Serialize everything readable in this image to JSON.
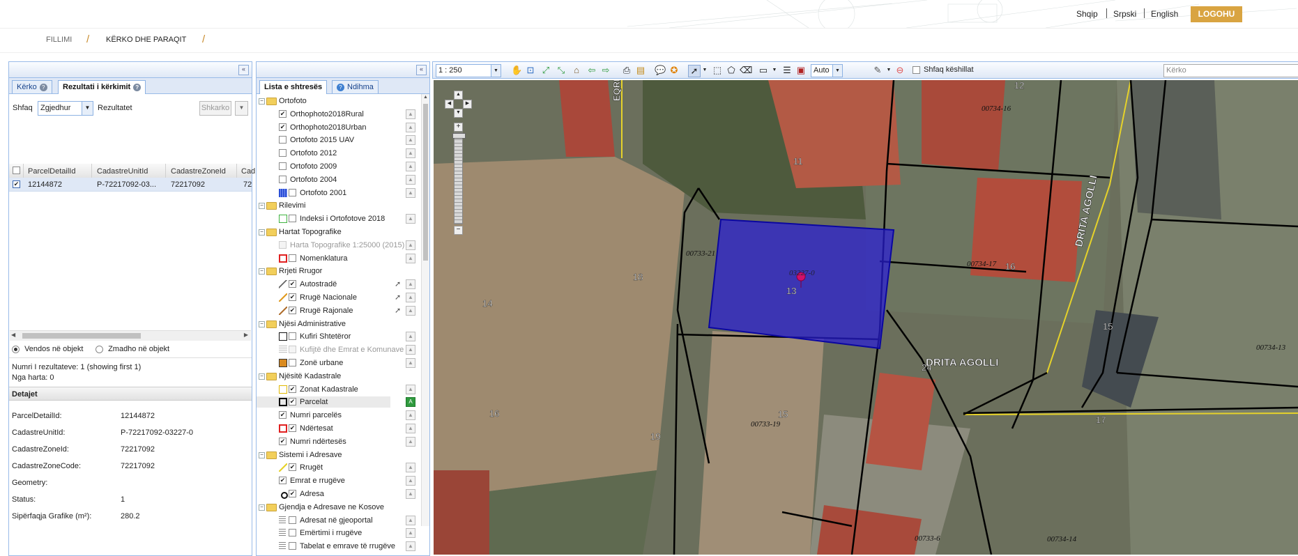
{
  "header": {
    "languages": [
      "Shqip",
      "Srpski",
      "English"
    ],
    "logout_label": "LOGOHU"
  },
  "breadcrumb": {
    "items": [
      "FILLIMI",
      "KËRKO DHE PARAQIT"
    ]
  },
  "left_panel": {
    "tabs": [
      {
        "label": "Kërko"
      },
      {
        "label": "Rezultati i kërkimit"
      }
    ],
    "filter": {
      "label": "Shfaq",
      "select_value": "Zgjedhur",
      "results_label": "Rezultatet",
      "clear_button": "Shkarko"
    },
    "grid": {
      "columns": [
        "ParcelDetailId",
        "CadastreUnitId",
        "CadastreZoneId",
        "Cad"
      ],
      "rows": [
        {
          "checked": true,
          "cells": [
            "12144872",
            "P-72217092-03...",
            "72217092",
            "72"
          ]
        }
      ]
    },
    "radio_options": [
      {
        "label": "Vendos në objekt",
        "selected": true
      },
      {
        "label": "Zmadho në objekt",
        "selected": false
      }
    ],
    "results_count": "Numri I rezultateve: 1 (showing first 1)",
    "from_map": "Nga harta: 0",
    "details_title": "Detajet",
    "details": [
      {
        "label": "ParcelDetailId:",
        "value": "12144872"
      },
      {
        "label": "CadastreUnitId:",
        "value": "P-72217092-03227-0"
      },
      {
        "label": "CadastreZoneId:",
        "value": "72217092"
      },
      {
        "label": "CadastreZoneCode:",
        "value": "72217092"
      },
      {
        "label": "Geometry:",
        "value": ""
      },
      {
        "label": "Status:",
        "value": "1"
      },
      {
        "label": "Sipërfaqja Grafike (m²):",
        "value": "280.2"
      }
    ]
  },
  "layers_panel": {
    "tabs": [
      {
        "label": "Lista e shtresës"
      },
      {
        "label": "Ndihma"
      }
    ],
    "tree": [
      {
        "type": "group",
        "label": "Ortofoto"
      },
      {
        "type": "layer",
        "label": "Orthophoto2018Rural",
        "checked": true,
        "legend": "none"
      },
      {
        "type": "layer",
        "label": "Orthophoto2018Urban",
        "checked": true,
        "legend": "none"
      },
      {
        "type": "layer",
        "label": "Ortofoto 2015 UAV",
        "checked": false,
        "legend": "none"
      },
      {
        "type": "layer",
        "label": "Ortofoto 2012",
        "checked": false,
        "legend": "none"
      },
      {
        "type": "layer",
        "label": "Ortofoto 2009",
        "checked": false,
        "legend": "none"
      },
      {
        "type": "layer",
        "label": "Ortofoto 2004",
        "checked": false,
        "legend": "none"
      },
      {
        "type": "layer",
        "label": "Ortofoto 2001",
        "checked": false,
        "legend": "blue-grid"
      },
      {
        "type": "group",
        "label": "Rilevimi"
      },
      {
        "type": "layer",
        "label": "Indeksi i Ortofotove 2018",
        "checked": false,
        "legend": "green-box"
      },
      {
        "type": "group",
        "label": "Hartat Topografike"
      },
      {
        "type": "layer",
        "label": "Harta Topografike 1:25000 (2015)",
        "checked": false,
        "legend": "none",
        "disabled": true
      },
      {
        "type": "layer",
        "label": "Nomenklatura",
        "checked": false,
        "legend": "red-box"
      },
      {
        "type": "group",
        "label": "Rrjeti Rrugor"
      },
      {
        "type": "layer",
        "label": "Autostradë",
        "checked": true,
        "legend": "road-small",
        "cursor": true
      },
      {
        "type": "layer",
        "label": "Rrugë Nacionale",
        "checked": true,
        "legend": "orange-line",
        "cursor": true
      },
      {
        "type": "layer",
        "label": "Rrugë Rajonale",
        "checked": true,
        "legend": "brown-line",
        "cursor": true
      },
      {
        "type": "group",
        "label": "Njësi Administrative"
      },
      {
        "type": "layer",
        "label": "Kufiri Shtetëror",
        "checked": false,
        "legend": "black-box"
      },
      {
        "type": "layer",
        "label": "Kufijtë dhe Emrat e Komunave",
        "checked": false,
        "legend": "gray-lines",
        "disabled": true
      },
      {
        "type": "layer",
        "label": "Zonë urbane",
        "checked": false,
        "legend": "orange-fill"
      },
      {
        "type": "group",
        "label": "Njësitë Kadastrale"
      },
      {
        "type": "layer",
        "label": "Zonat Kadastrale",
        "checked": true,
        "legend": "yellow-box"
      },
      {
        "type": "layer",
        "label": "Parcelat",
        "checked": true,
        "legend": "black-box-thick",
        "selected": true,
        "active_button": "A"
      },
      {
        "type": "layer",
        "label": "Numri parcelës",
        "checked": true,
        "legend": "none"
      },
      {
        "type": "layer",
        "label": "Ndërtesat",
        "checked": true,
        "legend": "red-box"
      },
      {
        "type": "layer",
        "label": "Numri ndërtesës",
        "checked": true,
        "legend": "none"
      },
      {
        "type": "group",
        "label": "Sistemi i Adresave"
      },
      {
        "type": "layer",
        "label": "Rrugët",
        "checked": true,
        "legend": "yellow-line"
      },
      {
        "type": "layer",
        "label": "Emrat e rrugëve",
        "checked": true,
        "legend": "none"
      },
      {
        "type": "layer",
        "label": "Adresa",
        "checked": true,
        "legend": "dot"
      },
      {
        "type": "group",
        "label": "Gjendja e Adresave ne Kosove"
      },
      {
        "type": "layer",
        "label": "Adresat në gjeoportal",
        "checked": false,
        "legend": "list"
      },
      {
        "type": "layer",
        "label": "Emërtimi i rrugëve",
        "checked": false,
        "legend": "list"
      },
      {
        "type": "layer",
        "label": "Tabelat e emrave të rrugëve",
        "checked": false,
        "legend": "list"
      }
    ]
  },
  "map_toolbar": {
    "scale": "1 : 250",
    "auto_select": "Auto",
    "tips_label": "Shfaq këshillat",
    "search_placeholder": "Kërko"
  },
  "map": {
    "labels": {
      "street_eqrem": "EQREM",
      "street_drita_vertical": "DRITA AGOLLI",
      "street_drita_horizontal": "DRITA AGOLLI",
      "p21": "00733-21",
      "p17": "00734-17",
      "p16": "00734-16",
      "p13": "00734-13",
      "p19": "00733-19",
      "p6": "00733-6",
      "p14": "00734-14",
      "psel": "03227-0",
      "n10": "10",
      "n12": "12",
      "n11": "11",
      "n18": "18",
      "n14": "14",
      "n13": "13",
      "n16a": "16",
      "n15a": "15",
      "n24": "24",
      "n15b": "15",
      "n16b": "16",
      "n19": "19",
      "n17": "17"
    }
  },
  "colors": {
    "logout_bg": "#d9a441",
    "selection_fill": "#2a1ed6",
    "highlight_row": "#dfe8f6"
  }
}
